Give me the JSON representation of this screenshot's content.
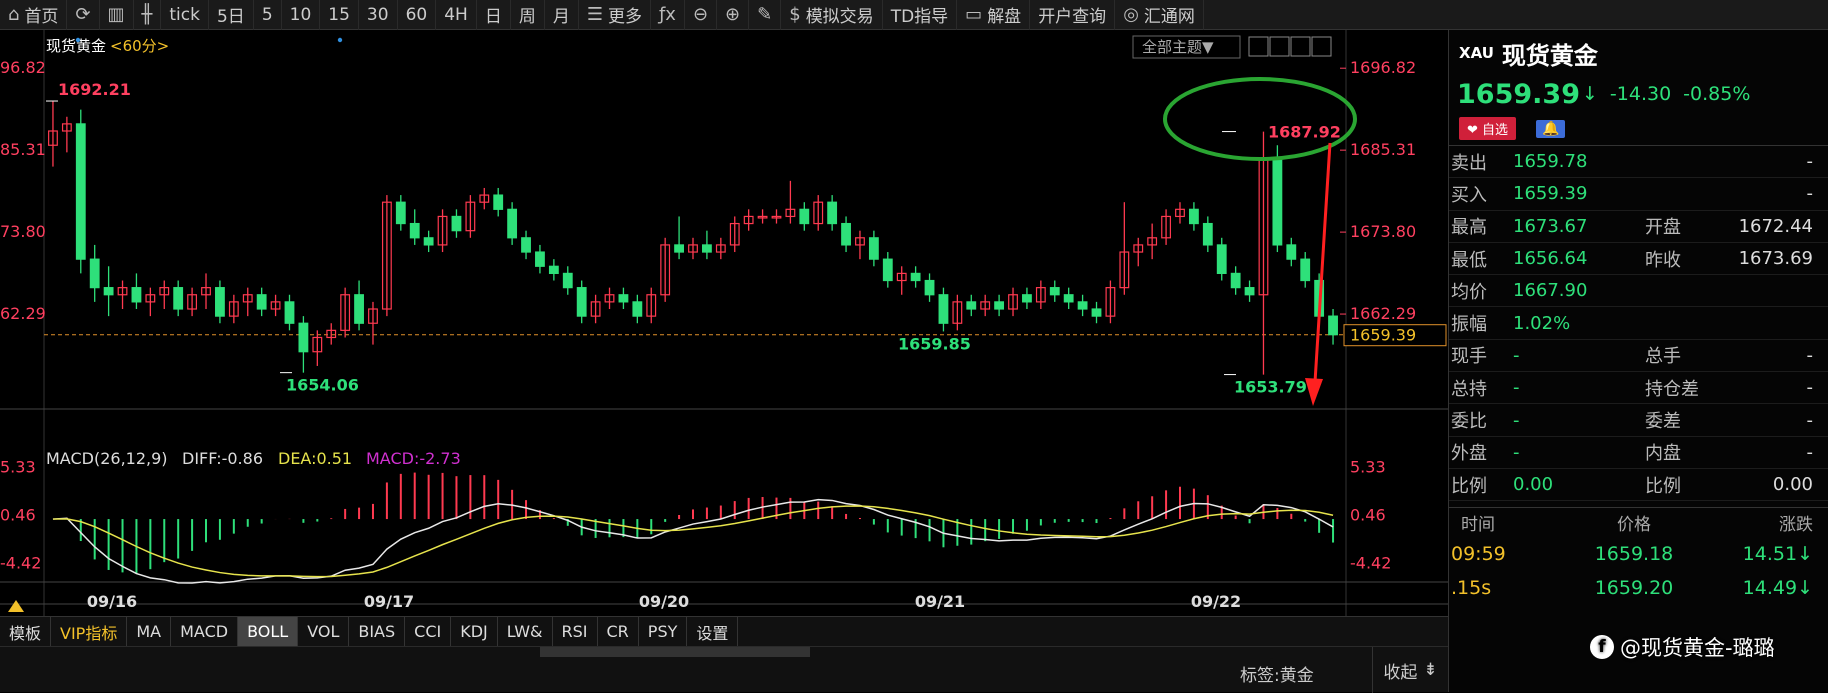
{
  "toolbar": [
    {
      "icon": "home-icon",
      "glyph": "⌂",
      "label": "首页"
    },
    {
      "icon": "refresh-icon",
      "glyph": "⟳",
      "label": ""
    },
    {
      "icon": "bar-chart-icon",
      "glyph": "▥",
      "label": ""
    },
    {
      "icon": "candles-icon",
      "glyph": "╫",
      "label": ""
    },
    {
      "icon": "",
      "glyph": "",
      "label": "tick"
    },
    {
      "icon": "",
      "glyph": "",
      "label": "5日"
    },
    {
      "icon": "",
      "glyph": "",
      "label": "5"
    },
    {
      "icon": "",
      "glyph": "",
      "label": "10"
    },
    {
      "icon": "",
      "glyph": "",
      "label": "15"
    },
    {
      "icon": "",
      "glyph": "",
      "label": "30"
    },
    {
      "icon": "",
      "glyph": "",
      "label": "60"
    },
    {
      "icon": "",
      "glyph": "",
      "label": "4H"
    },
    {
      "icon": "",
      "glyph": "",
      "label": "日"
    },
    {
      "icon": "",
      "glyph": "",
      "label": "周"
    },
    {
      "icon": "",
      "glyph": "",
      "label": "月"
    },
    {
      "icon": "menu-icon",
      "glyph": "☰",
      "label": "更多"
    },
    {
      "icon": "formula-icon",
      "glyph": "ƒx",
      "label": ""
    },
    {
      "icon": "zoom-out-icon",
      "glyph": "⊖",
      "label": ""
    },
    {
      "icon": "zoom-in-icon",
      "glyph": "⊕",
      "label": ""
    },
    {
      "icon": "pen-icon",
      "glyph": "✎",
      "label": ""
    },
    {
      "icon": "dollar-icon",
      "glyph": "$",
      "label": "模拟交易"
    },
    {
      "icon": "",
      "glyph": "",
      "label": "TD指导"
    },
    {
      "icon": "chat-icon",
      "glyph": "▭",
      "label": "解盘"
    },
    {
      "icon": "",
      "glyph": "",
      "label": "开户查询"
    },
    {
      "icon": "swirl-icon",
      "glyph": "◎",
      "label": "汇通网"
    }
  ],
  "main_chart": {
    "title": "现货黄金",
    "period": "<60分>",
    "dropdown": "全部主题▼",
    "y_ticks": [
      "1696.82",
      "1685.31",
      "1673.80",
      "1662.29"
    ],
    "y_ticks_left": [
      "96.82",
      "85.31",
      "73.80",
      "62.29"
    ],
    "last_price": "1659.39",
    "annotations": {
      "high_left": "1692.21",
      "high_right": "1687.92",
      "low_left": "1654.06",
      "low_mid": "1659.85",
      "low_right": "1653.79"
    }
  },
  "macd": {
    "label": "MACD(26,12,9)",
    "diff": "DIFF:-0.86",
    "dea": "DEA:0.51",
    "macd": "MACD:-2.73",
    "ticks": [
      "5.33",
      "0.46",
      "-4.42"
    ]
  },
  "x_labels": [
    "09/16",
    "09/17",
    "09/20",
    "09/21",
    "09/22"
  ],
  "chart_data": {
    "type": "candlestick",
    "title": "现货黄金",
    "period": "60分",
    "ylim": [
      1650.5,
      1700.5
    ],
    "y_ticks": [
      1696.82,
      1685.31,
      1673.8,
      1662.29
    ],
    "x_labels": [
      "09/16",
      "09/17",
      "09/20",
      "09/21",
      "09/22"
    ],
    "last_price": 1659.39,
    "ohlc": [
      [
        1686,
        1692.21,
        1683,
        1688
      ],
      [
        1688,
        1690,
        1685,
        1689
      ],
      [
        1689,
        1691,
        1668,
        1670
      ],
      [
        1670,
        1672,
        1664,
        1666
      ],
      [
        1666,
        1669,
        1662,
        1665
      ],
      [
        1665,
        1667,
        1663,
        1666
      ],
      [
        1666,
        1668,
        1663,
        1664
      ],
      [
        1664,
        1666,
        1662,
        1665
      ],
      [
        1665,
        1667,
        1663,
        1666
      ],
      [
        1666,
        1667,
        1662,
        1663
      ],
      [
        1663,
        1666,
        1662,
        1665
      ],
      [
        1665,
        1668,
        1663,
        1666
      ],
      [
        1666,
        1667,
        1661,
        1662
      ],
      [
        1662,
        1665,
        1661,
        1664
      ],
      [
        1664,
        1666,
        1662,
        1665
      ],
      [
        1665,
        1666,
        1662,
        1663
      ],
      [
        1663,
        1665,
        1662,
        1664
      ],
      [
        1664,
        1665,
        1660,
        1661
      ],
      [
        1661,
        1662,
        1654.06,
        1657
      ],
      [
        1657,
        1660,
        1655,
        1659
      ],
      [
        1659,
        1661,
        1658,
        1660
      ],
      [
        1660,
        1666,
        1659,
        1665
      ],
      [
        1665,
        1667,
        1660,
        1661
      ],
      [
        1661,
        1664,
        1658,
        1663
      ],
      [
        1663,
        1679,
        1662,
        1678
      ],
      [
        1678,
        1679,
        1674,
        1675
      ],
      [
        1675,
        1677,
        1672,
        1673
      ],
      [
        1673,
        1674,
        1671,
        1672
      ],
      [
        1672,
        1677,
        1671,
        1676
      ],
      [
        1676,
        1677,
        1673,
        1674
      ],
      [
        1674,
        1679,
        1673,
        1678
      ],
      [
        1678,
        1680,
        1677,
        1679
      ],
      [
        1679,
        1680,
        1676,
        1677
      ],
      [
        1677,
        1678,
        1672,
        1673
      ],
      [
        1673,
        1674,
        1670,
        1671
      ],
      [
        1671,
        1672,
        1668,
        1669
      ],
      [
        1669,
        1670,
        1667,
        1668
      ],
      [
        1668,
        1669,
        1665,
        1666
      ],
      [
        1666,
        1667,
        1661,
        1662
      ],
      [
        1662,
        1665,
        1661,
        1664
      ],
      [
        1664,
        1666,
        1663,
        1665
      ],
      [
        1665,
        1666,
        1663,
        1664
      ],
      [
        1664,
        1665,
        1661,
        1662
      ],
      [
        1662,
        1666,
        1661,
        1665
      ],
      [
        1665,
        1673,
        1664,
        1672
      ],
      [
        1672,
        1676,
        1670,
        1671
      ],
      [
        1671,
        1673,
        1670,
        1672
      ],
      [
        1672,
        1674,
        1670,
        1671
      ],
      [
        1671,
        1673,
        1670,
        1672
      ],
      [
        1672,
        1676,
        1671,
        1675
      ],
      [
        1675,
        1677,
        1674,
        1676
      ],
      [
        1676,
        1677,
        1675,
        1676
      ],
      [
        1676,
        1677,
        1675,
        1676
      ],
      [
        1676,
        1681,
        1675,
        1677
      ],
      [
        1677,
        1678,
        1674,
        1675
      ],
      [
        1675,
        1679,
        1674,
        1678
      ],
      [
        1678,
        1679,
        1674,
        1675
      ],
      [
        1675,
        1676,
        1671,
        1672
      ],
      [
        1672,
        1674,
        1670,
        1673
      ],
      [
        1673,
        1674,
        1669,
        1670
      ],
      [
        1670,
        1671,
        1666,
        1667
      ],
      [
        1667,
        1669,
        1665,
        1668
      ],
      [
        1668,
        1669,
        1666,
        1667
      ],
      [
        1667,
        1668,
        1664,
        1665
      ],
      [
        1665,
        1666,
        1659.85,
        1661
      ],
      [
        1661,
        1665,
        1660,
        1664
      ],
      [
        1664,
        1665,
        1662,
        1663
      ],
      [
        1663,
        1665,
        1662,
        1664
      ],
      [
        1664,
        1665,
        1662,
        1663
      ],
      [
        1663,
        1666,
        1662,
        1665
      ],
      [
        1665,
        1666,
        1663,
        1664
      ],
      [
        1664,
        1667,
        1663,
        1666
      ],
      [
        1666,
        1667,
        1664,
        1665
      ],
      [
        1665,
        1666,
        1663,
        1664
      ],
      [
        1664,
        1665,
        1662,
        1663
      ],
      [
        1663,
        1664,
        1661,
        1662
      ],
      [
        1662,
        1667,
        1661,
        1666
      ],
      [
        1666,
        1678,
        1665,
        1671
      ],
      [
        1671,
        1673,
        1669,
        1672
      ],
      [
        1672,
        1675,
        1670,
        1673
      ],
      [
        1673,
        1677,
        1672,
        1676
      ],
      [
        1676,
        1678,
        1675,
        1677
      ],
      [
        1677,
        1678,
        1674,
        1675
      ],
      [
        1675,
        1676,
        1671,
        1672
      ],
      [
        1672,
        1673,
        1667,
        1668
      ],
      [
        1668,
        1669,
        1665,
        1666
      ],
      [
        1666,
        1667,
        1664,
        1665
      ],
      [
        1665,
        1687.92,
        1653.79,
        1684
      ],
      [
        1684,
        1686,
        1671,
        1672
      ],
      [
        1672,
        1673,
        1669,
        1670
      ],
      [
        1670,
        1671,
        1666,
        1667
      ],
      [
        1667,
        1668,
        1661,
        1662
      ],
      [
        1662,
        1663,
        1658,
        1659.39
      ]
    ],
    "macd": {
      "label": "MACD(26,12,9)",
      "diff": -0.86,
      "dea": 0.51,
      "macd": -2.73,
      "ticks": [
        5.33,
        0.46,
        -4.42
      ]
    }
  },
  "panel": {
    "symbol": "XAU",
    "name": "现货黄金",
    "price": "1659.39",
    "arrow": "↓",
    "change": "-14.30",
    "change_pct": "-0.85%",
    "fav": "❤ 自选",
    "bell": "🔔",
    "rows": [
      {
        "l": "卖出",
        "v": "1659.78",
        "l2": "",
        "v2": "-"
      },
      {
        "l": "买入",
        "v": "1659.39",
        "l2": "",
        "v2": "-"
      },
      {
        "l": "最高",
        "v": "1673.67",
        "l2": "开盘",
        "v2": "1672.44"
      },
      {
        "l": "最低",
        "v": "1656.64",
        "l2": "昨收",
        "v2": "1673.69"
      },
      {
        "l": "均价",
        "v": "1667.90",
        "l2": "",
        "v2": ""
      },
      {
        "l": "振幅",
        "v": "1.02%",
        "l2": "",
        "v2": ""
      },
      {
        "l": "现手",
        "v": "-",
        "l2": "总手",
        "v2": "-"
      },
      {
        "l": "总持",
        "v": "-",
        "l2": "持仓差",
        "v2": "-"
      },
      {
        "l": "委比",
        "v": "-",
        "l2": "委差",
        "v2": "-"
      },
      {
        "l": "外盘",
        "v": "-",
        "l2": "内盘",
        "v2": "-"
      },
      {
        "l": "比例",
        "v": "0.00",
        "l2": "比例",
        "v2": "0.00"
      }
    ],
    "trade_head": [
      "时间",
      "价格",
      "涨跌"
    ],
    "trades": [
      {
        "t": "09:59",
        "p": "1659.18",
        "c": "14.51↓"
      },
      {
        "t": ".15s",
        "p": "1659.20",
        "c": "14.49↓"
      }
    ]
  },
  "indicators": [
    "模板",
    "VIP指标",
    "MA",
    "MACD",
    "BOLL",
    "VOL",
    "BIAS",
    "CCI",
    "KDJ",
    "LW&",
    "RSI",
    "CR",
    "PSY",
    "设置"
  ],
  "footer": {
    "tag": "标签:黄金",
    "collapse": "收起"
  },
  "watermark": "@现货黄金-璐璐",
  "colors": {
    "up": "#ff3a50",
    "down": "#2ee07a",
    "diff": "#e8e8e8",
    "dea": "#e6e34c",
    "macd": "#d030d0",
    "annotation": "#2aa532",
    "arrow": "#ff2020"
  }
}
